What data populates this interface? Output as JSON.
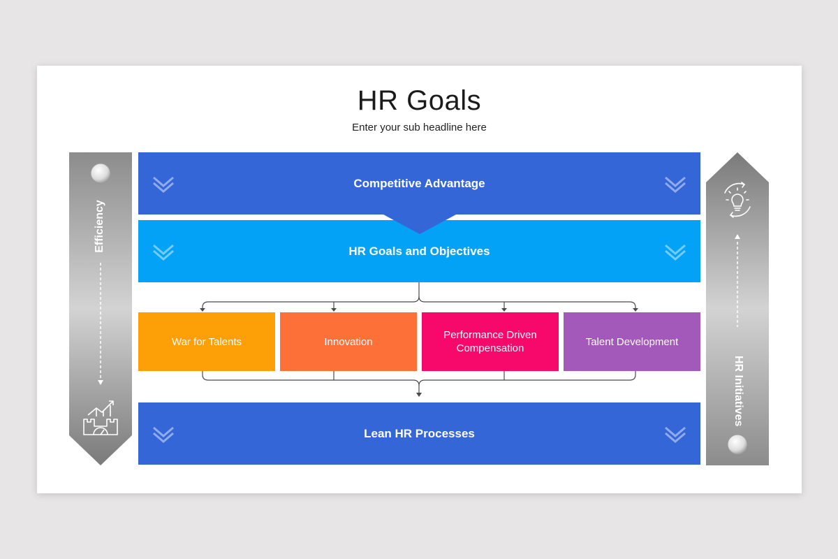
{
  "slide": {
    "title": "HR Goals",
    "subtitle": "Enter your sub headline here"
  },
  "bands": {
    "top": "Competitive Advantage",
    "middle": "HR Goals and Objectives",
    "bottom": "Lean HR Processes"
  },
  "boxes": [
    {
      "label": "War for Talents",
      "color": "#fd9f07"
    },
    {
      "label": "Innovation",
      "color": "#fd7138"
    },
    {
      "label": "Performance Driven Compensation",
      "color": "#f7096c"
    },
    {
      "label": "Talent Development",
      "color": "#a259b9"
    }
  ],
  "sidebars": {
    "left": {
      "label": "Efficiency",
      "icon": "growth-castle-gauge-icon"
    },
    "right": {
      "label": "HR Initiatives",
      "icon": "lightbulb-gear-icon"
    }
  },
  "colors": {
    "band_blue": "#3566d8",
    "band_light_blue": "#03a2f7",
    "sidebar_gray": "#8f8f8f"
  }
}
